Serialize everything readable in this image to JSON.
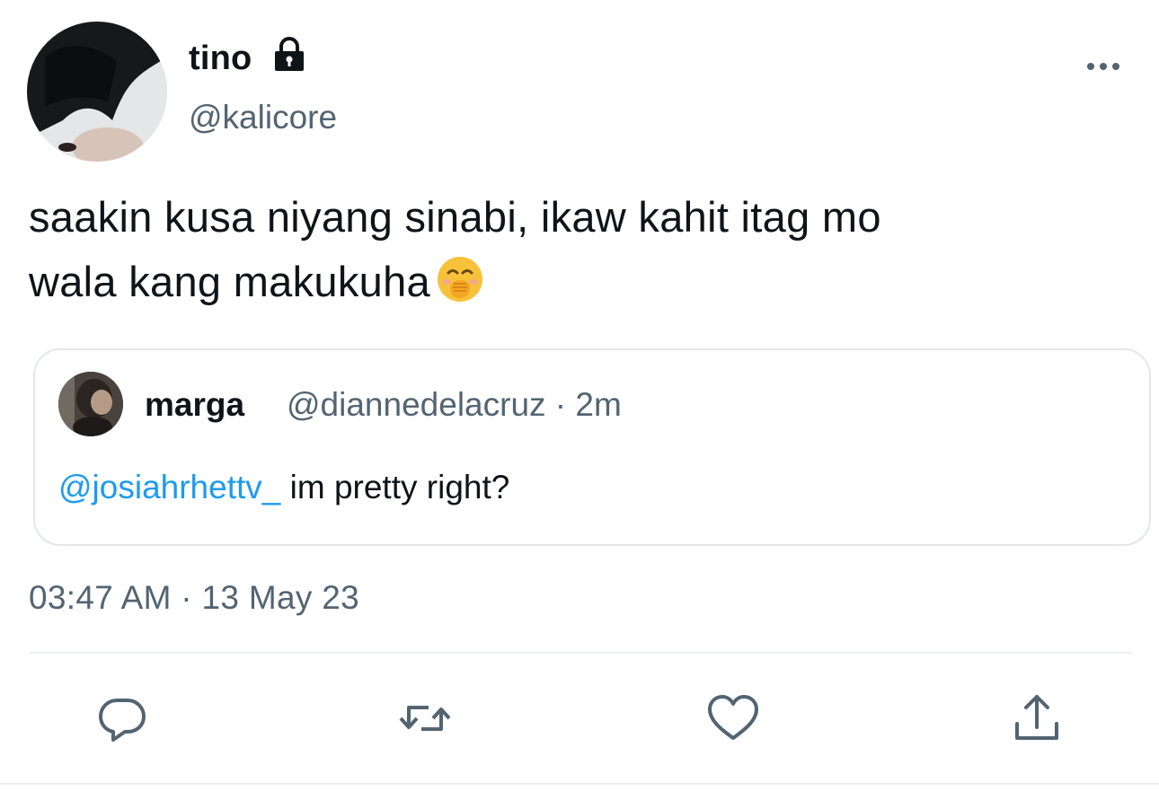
{
  "author": {
    "name": "tino",
    "handle": "@kalicore",
    "protected_icon": "lock-icon",
    "avatar": "avatar"
  },
  "menu_icon": "more-icon",
  "tweet": {
    "text_line1": "saakin kusa niyang sinabi, ikaw kahit itag mo",
    "text_line2": "wala kang makukuha",
    "emoji": "face-with-hand-over-mouth-emoji"
  },
  "quote": {
    "name": "marga",
    "meta": "@diannedelacruz · 2m",
    "mention": "@josiahrhettv_",
    "text": " im pretty right?"
  },
  "timestamp": "03:47 AM · 13 May 23",
  "actions": [
    {
      "icon": "reply-icon"
    },
    {
      "icon": "retweet-icon"
    },
    {
      "icon": "like-icon"
    },
    {
      "icon": "share-icon"
    }
  ],
  "colors": {
    "text": "#0f1419",
    "secondary": "#536471",
    "link": "#1d9bf0",
    "border": "#e3e7ea"
  }
}
